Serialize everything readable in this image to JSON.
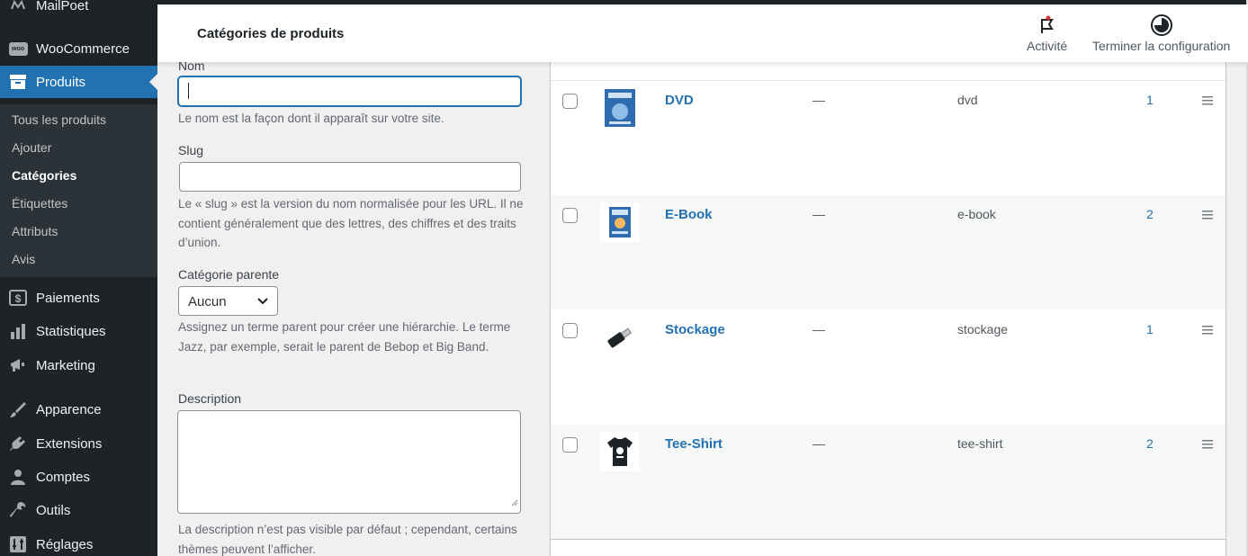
{
  "header": {
    "page_title": "Catégories de produits",
    "activity_label": "Activité",
    "finish_setup_label": "Terminer la configuration"
  },
  "sidebar": {
    "items": [
      {
        "label": "MailPoet",
        "icon": "mailpoet-icon"
      },
      {
        "label": "WooCommerce",
        "icon": "woocommerce-icon"
      },
      {
        "label": "Produits",
        "icon": "archive-icon"
      },
      {
        "label": "Paiements",
        "icon": "dollar-icon"
      },
      {
        "label": "Statistiques",
        "icon": "chart-bar-icon"
      },
      {
        "label": "Marketing",
        "icon": "megaphone-icon"
      },
      {
        "label": "Apparence",
        "icon": "paintbrush-icon"
      },
      {
        "label": "Extensions",
        "icon": "plugins-icon"
      },
      {
        "label": "Comptes",
        "icon": "users-icon"
      },
      {
        "label": "Outils",
        "icon": "wrench-icon"
      },
      {
        "label": "Réglages",
        "icon": "settings-icon"
      }
    ],
    "submenu": [
      "Tous les produits",
      "Ajouter",
      "Catégories",
      "Étiquettes",
      "Attributs",
      "Avis"
    ],
    "woo_badge": "woo"
  },
  "form": {
    "name_label": "Nom",
    "name_value": "",
    "name_help": "Le nom est la façon dont il apparaît sur votre site.",
    "slug_label": "Slug",
    "slug_value": "",
    "slug_help": "Le « slug » est la version du nom normalisée pour les URL. Il ne contient généralement que des lettres, des chiffres et des traits d’union.",
    "parent_label": "Catégorie parente",
    "parent_value": "Aucun",
    "parent_help": "Assignez un terme parent pour créer une hiérarchie. Le terme Jazz, par exemple, serait le parent de Bebop et Big Band.",
    "description_label": "Description",
    "description_value": "",
    "description_help": "La description n’est pas visible par défaut ; cependant, certains thèmes peuvent l’afficher."
  },
  "table": {
    "rows": [
      {
        "name": "DVD",
        "description": "—",
        "slug": "dvd",
        "count": "1",
        "thumb": "dvd-thumbnail"
      },
      {
        "name": "E-Book",
        "description": "—",
        "slug": "e-book",
        "count": "2",
        "thumb": "ebook-thumbnail"
      },
      {
        "name": "Stockage",
        "description": "—",
        "slug": "stockage",
        "count": "1",
        "thumb": "usb-drive-thumbnail"
      },
      {
        "name": "Tee-Shirt",
        "description": "—",
        "slug": "tee-shirt",
        "count": "2",
        "thumb": "tshirt-thumbnail"
      }
    ]
  },
  "colors": {
    "sidebar_bg": "#1d2327",
    "accent": "#2271b1",
    "link": "#2271b1"
  }
}
